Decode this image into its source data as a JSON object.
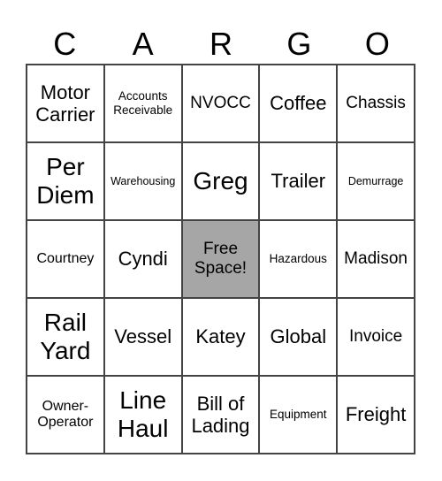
{
  "header": [
    "C",
    "A",
    "R",
    "G",
    "O"
  ],
  "cells": [
    [
      "Motor Carrier",
      "Accounts Receivable",
      "NVOCC",
      "Coffee",
      "Chassis"
    ],
    [
      "Per Diem",
      "Warehousing",
      "Greg",
      "Trailer",
      "Demurrage"
    ],
    [
      "Courtney",
      "Cyndi",
      "Free Space!",
      "Hazardous",
      "Madison"
    ],
    [
      "Rail Yard",
      "Vessel",
      "Katey",
      "Global",
      "Invoice"
    ],
    [
      "Owner-Operator",
      "Line Haul",
      "Bill of Lading",
      "Equipment",
      "Freight"
    ]
  ],
  "free_space_color": "#a6a6a6"
}
